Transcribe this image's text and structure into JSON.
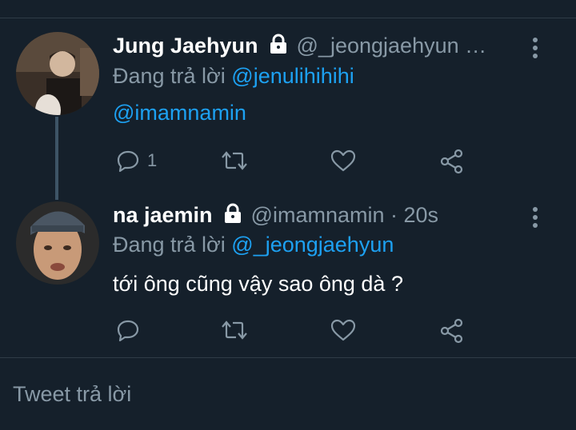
{
  "tweets": [
    {
      "name": "Jung Jaehyun",
      "handle": "@_jeongjaehyun …",
      "replying_prefix": "Đang trả lời",
      "replying_to": "@jenulihihihi",
      "text": "@imamnamin",
      "reply_count": "1"
    },
    {
      "name": "na jaemin",
      "handle": "@imamnamin · 20s",
      "replying_prefix": "Đang trả lời",
      "replying_to": "@_jeongjaehyun",
      "text": "tới ông cũng vậy sao ông dà ?",
      "reply_count": ""
    }
  ],
  "reply_box": {
    "placeholder": "Tweet trả lời"
  },
  "icons": [
    "lock-icon",
    "reply-icon",
    "retweet-icon",
    "like-icon",
    "share-icon",
    "more-icon"
  ],
  "colors": {
    "background": "#15202b",
    "accent": "#1da1f2",
    "muted": "#8899a6",
    "divider": "#2f3b47"
  }
}
